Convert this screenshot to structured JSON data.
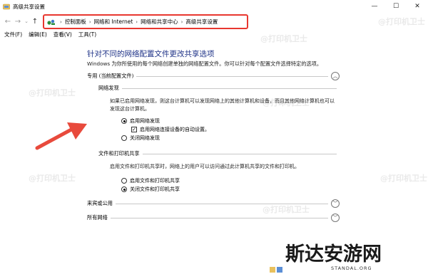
{
  "window": {
    "title": "高级共享设置"
  },
  "address_bar": {
    "crumbs": [
      "控制面板",
      "网络和 Internet",
      "网络和共享中心",
      "高级共享设置"
    ]
  },
  "menu": [
    "文件(F)",
    "编辑(E)",
    "查看(V)",
    "工具(T)"
  ],
  "page": {
    "heading": "针对不同的网络配置文件更改共享选项",
    "description": "Windows 为你所使用的每个网络创建单独的网络配置文件。你可以针对每个配置文件选择特定的选项。"
  },
  "profiles": {
    "private": {
      "label": "专用 (当前配置文件)",
      "network_discovery": {
        "title": "网络发现",
        "text": "如果已启用网络发现，则这台计算机可以发现网络上的其他计算机和设备，而且其他网络计算机也可以发现这台计算机。",
        "options": {
          "enable": "启用网络发现",
          "auto_setup": "启用网络连接设备的自动设置。",
          "disable": "关闭网络发现"
        }
      },
      "file_printer_sharing": {
        "title": "文件和打印机共享",
        "text": "启用文件和打印机共享时，网络上的用户可以访问通过此计算机共享的文件和打印机。",
        "options": {
          "enable": "启用文件和打印机共享",
          "disable": "关闭文件和打印机共享"
        }
      }
    },
    "guest_public": {
      "label": "来宾或公用"
    },
    "all_networks": {
      "label": "所有网络"
    }
  },
  "state": {
    "network_discovery": "enable",
    "auto_setup_checked": true,
    "file_printer_sharing": "disable"
  },
  "watermarks": [
    "@打印机卫士",
    "@打印机卫士",
    "@打印机卫士",
    "@打印机卫士",
    "@打印机卫士",
    "@打印机卫士",
    "@打印机卫士"
  ],
  "logo": {
    "text": "斯达安游网",
    "sub": "STANDAL.ORG"
  },
  "colors": {
    "heading": "#1e3287",
    "annotation_red": "#e8372f",
    "arrow_red": "#e84a3c"
  }
}
